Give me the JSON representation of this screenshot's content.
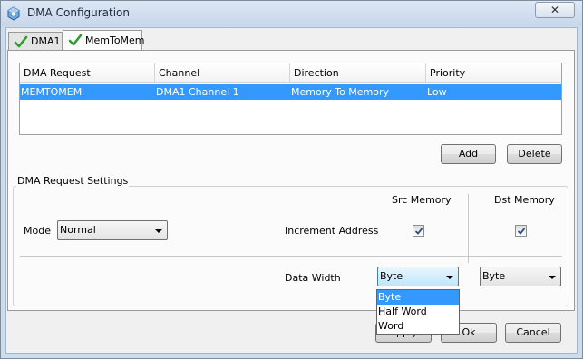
{
  "window": {
    "title": "DMA Configuration",
    "close_glyph": "✕",
    "icon": "gear-cube-icon"
  },
  "tabs": [
    {
      "label": "DMA1",
      "icon": "green-check-icon",
      "active": false
    },
    {
      "label": "MemToMem",
      "icon": "green-check-icon",
      "active": true
    }
  ],
  "table": {
    "columns": [
      "DMA Request",
      "Channel",
      "Direction",
      "Priority"
    ],
    "rows": [
      {
        "request": "MEMTOMEM",
        "channel": "DMA1 Channel 1",
        "direction": "Memory To Memory",
        "priority": "Low",
        "selected": true
      }
    ]
  },
  "table_buttons": {
    "add": "Add",
    "delete": "Delete"
  },
  "settings": {
    "group_title": "DMA Request Settings",
    "mode_label": "Mode",
    "mode_value": "Normal",
    "src_header": "Src Memory",
    "dst_header": "Dst Memory",
    "increment_label": "Increment Address",
    "src_increment": true,
    "dst_increment": true,
    "data_width_label": "Data Width",
    "src_width": "Byte",
    "dst_width": "Byte",
    "width_options": [
      "Byte",
      "Half Word",
      "Word"
    ],
    "highlighted_option": "Byte"
  },
  "footer": {
    "apply": "Apply",
    "ok": "Ok",
    "cancel": "Cancel"
  },
  "colors": {
    "selection": "#3399ff",
    "check_green": "#2e9d2e"
  }
}
